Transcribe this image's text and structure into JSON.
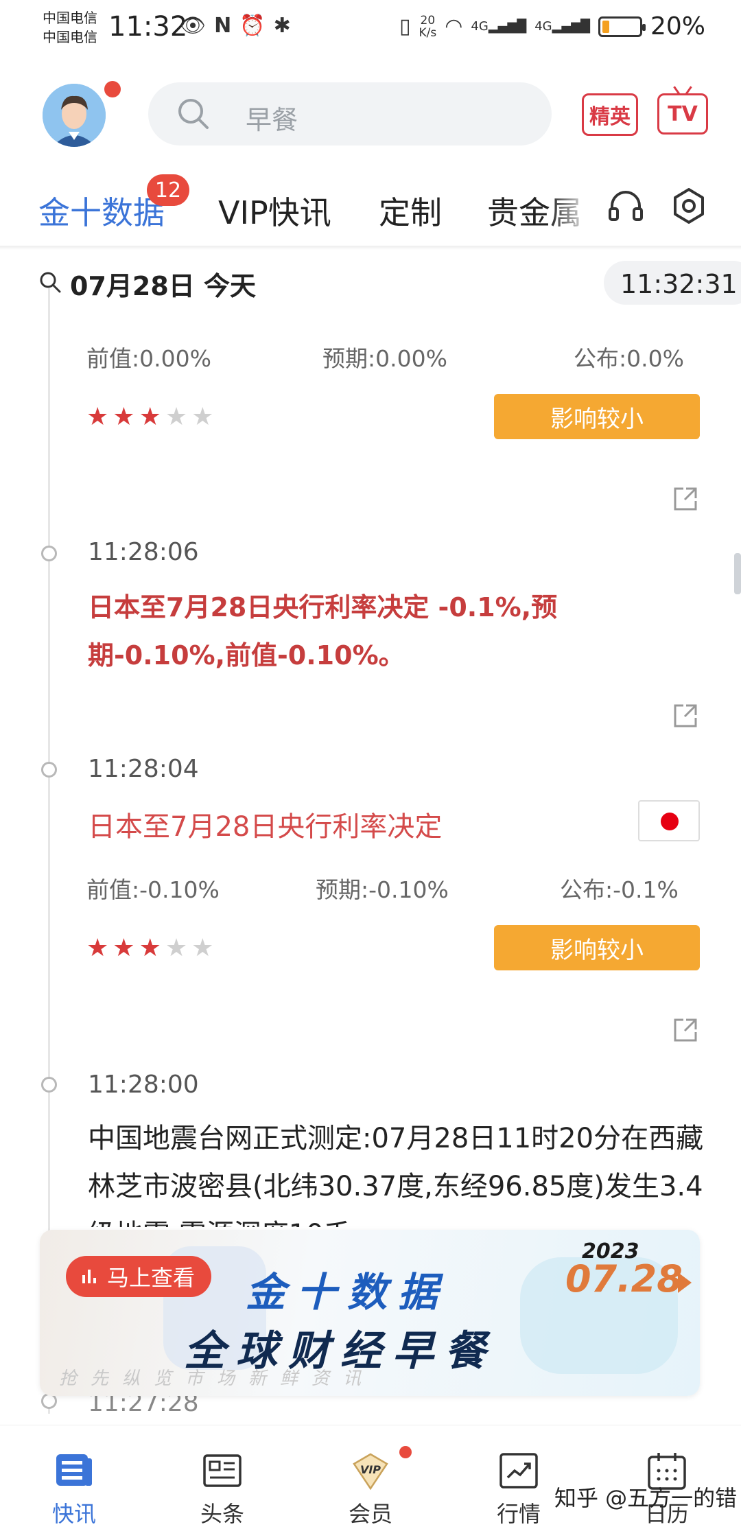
{
  "status_bar": {
    "carrier_1": "中国电信",
    "carrier_2": "中国电信",
    "time": "11:32",
    "net_speed_value": "20",
    "net_speed_unit": "K/s",
    "signal_1": "4G",
    "signal_2": "4G",
    "battery_percent_text": "20%",
    "battery_level": 0.2
  },
  "header": {
    "search_placeholder": "早餐",
    "elite_button": "精英",
    "tv_button": "TV"
  },
  "tabs": {
    "items": [
      {
        "label": "金十数据",
        "active": true
      },
      {
        "label": "VIP快讯",
        "active": false
      },
      {
        "label": "定制",
        "active": false
      },
      {
        "label": "贵金属",
        "active": false
      }
    ],
    "badge": "12"
  },
  "date_bar": {
    "date": "07月28日 今天",
    "clock": "11:32:31"
  },
  "feed": {
    "item0": {
      "prev_label": "前值:",
      "prev_value": "0.00%",
      "forecast_label": "预期:",
      "forecast_value": "0.00%",
      "actual_label": "公布:",
      "actual_value": "0.0%",
      "stars": 3,
      "impact": "影响较小"
    },
    "item1": {
      "time": "11:28:06",
      "text": "日本至7月28日央行利率决定 -0.1%,预期-0.10%,前值-0.10%。"
    },
    "item2": {
      "time": "11:28:04",
      "title": "日本至7月28日央行利率决定",
      "prev_label": "前值:",
      "prev_value": "-0.10%",
      "forecast_label": "预期:",
      "forecast_value": "-0.10%",
      "actual_label": "公布:",
      "actual_value": "-0.1%",
      "stars": 3,
      "impact": "影响较小"
    },
    "item3": {
      "time": "11:28:00",
      "text": "中国地震台网正式测定:07月28日11时20分在西藏林芝市波密县(北纬30.37度,东经96.85度)发生3.4级地震,震源深度10千"
    },
    "item4": {
      "time": "11:27:28"
    }
  },
  "banner": {
    "button": "马上查看",
    "title_1": "金十数据",
    "title_2": "全球财经早餐",
    "year": "2023",
    "date": "07.28",
    "slogan": "抢先纵览市场新鲜资讯"
  },
  "bottom_nav": {
    "items": [
      {
        "label": "快讯",
        "icon": "news-flash-icon",
        "active": true
      },
      {
        "label": "头条",
        "icon": "headline-icon",
        "active": false
      },
      {
        "label": "会员",
        "icon": "vip-icon",
        "active": false
      },
      {
        "label": "行情",
        "icon": "market-chart-icon",
        "active": false
      },
      {
        "label": "日历",
        "icon": "calendar-icon",
        "active": false
      }
    ]
  },
  "watermark": "知乎 @五方一的错",
  "colors": {
    "accent_blue": "#3b74d8",
    "news_red": "#c63d3d",
    "impact_orange": "#f5a832",
    "badge_red": "#e84a3d"
  }
}
